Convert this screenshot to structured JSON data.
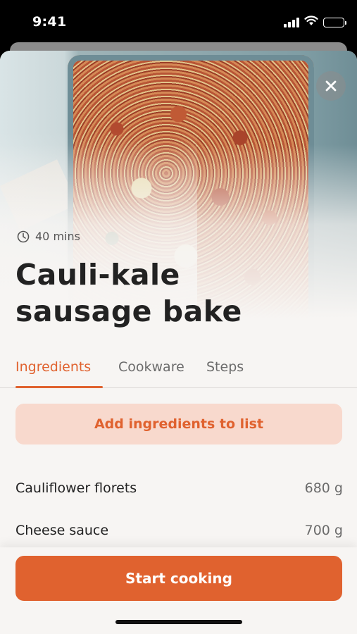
{
  "status_bar": {
    "time": "9:41"
  },
  "recipe": {
    "duration": "40 mins",
    "title_line1": "Cauli-kale",
    "title_line2": "sausage bake"
  },
  "tabs": [
    {
      "label": "Ingredients",
      "active": true
    },
    {
      "label": "Cookware",
      "active": false
    },
    {
      "label": "Steps",
      "active": false
    }
  ],
  "add_to_list_label": "Add ingredients to list",
  "ingredients": [
    {
      "name": "Cauliflower florets",
      "quantity": "680 g"
    },
    {
      "name": "Cheese sauce",
      "quantity": "700 g"
    }
  ],
  "start_cooking_label": "Start cooking",
  "colors": {
    "accent": "#e0622f",
    "accent_light": "#f8d9cd",
    "background": "#f7f5f3",
    "text": "#222222"
  },
  "icons": {
    "close": "close-icon",
    "clock": "clock-icon",
    "signal": "signal-icon",
    "wifi": "wifi-icon",
    "battery": "battery-icon"
  }
}
